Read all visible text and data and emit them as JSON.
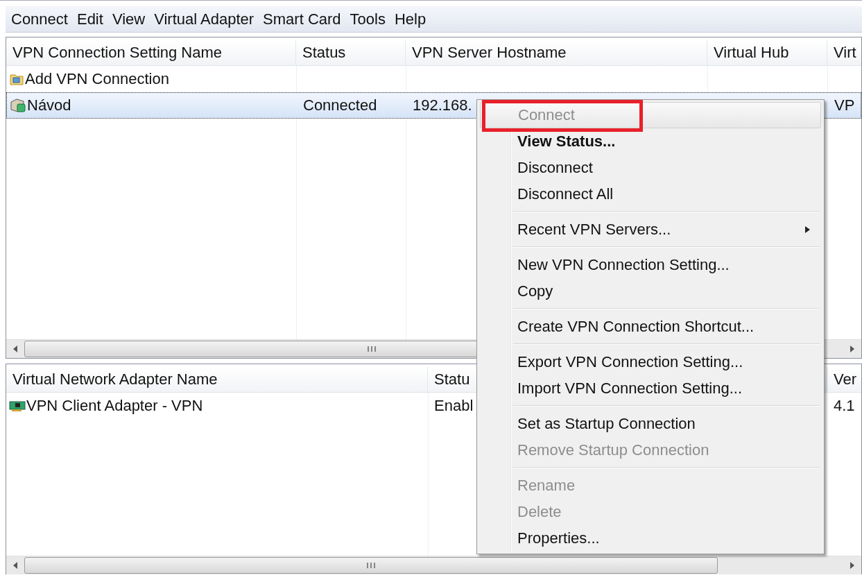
{
  "menubar": [
    {
      "label": "Connect"
    },
    {
      "label": "Edit"
    },
    {
      "label": "View"
    },
    {
      "label": "Virtual Adapter"
    },
    {
      "label": "Smart Card"
    },
    {
      "label": "Tools"
    },
    {
      "label": "Help"
    }
  ],
  "connections": {
    "columns": [
      "VPN Connection Setting Name",
      "Status",
      "VPN Server Hostname",
      "Virtual Hub",
      "Virt"
    ],
    "rows": [
      {
        "kind": "add",
        "selected": false,
        "cells": [
          "Add VPN Connection",
          "",
          "",
          "",
          ""
        ]
      },
      {
        "kind": "connection",
        "selected": true,
        "cells": [
          "Návod",
          "Connected",
          "192.168.",
          "",
          "VP"
        ]
      }
    ]
  },
  "adapters": {
    "columns": [
      "Virtual Network Adapter Name",
      "Statu",
      "Ver"
    ],
    "rows": [
      {
        "kind": "adapter",
        "cells": [
          "VPN Client Adapter - VPN",
          "Enabl",
          "4.1"
        ]
      }
    ]
  },
  "context_menu": {
    "items": [
      {
        "kind": "item",
        "label": "Connect",
        "disabled": true,
        "bold": false,
        "selected": true,
        "submenu": false,
        "highlighted_frame": true
      },
      {
        "kind": "item",
        "label": "View Status...",
        "disabled": false,
        "bold": true,
        "selected": false,
        "submenu": false
      },
      {
        "kind": "item",
        "label": "Disconnect",
        "disabled": false,
        "bold": false,
        "selected": false,
        "submenu": false
      },
      {
        "kind": "item",
        "label": "Disconnect All",
        "disabled": false,
        "bold": false,
        "selected": false,
        "submenu": false
      },
      {
        "kind": "separator"
      },
      {
        "kind": "item",
        "label": "Recent VPN Servers...",
        "disabled": false,
        "bold": false,
        "selected": false,
        "submenu": true
      },
      {
        "kind": "separator"
      },
      {
        "kind": "item",
        "label": "New VPN Connection Setting...",
        "disabled": false,
        "bold": false,
        "selected": false,
        "submenu": false
      },
      {
        "kind": "item",
        "label": "Copy",
        "disabled": false,
        "bold": false,
        "selected": false,
        "submenu": false
      },
      {
        "kind": "separator"
      },
      {
        "kind": "item",
        "label": "Create VPN Connection Shortcut...",
        "disabled": false,
        "bold": false,
        "selected": false,
        "submenu": false
      },
      {
        "kind": "separator"
      },
      {
        "kind": "item",
        "label": "Export VPN Connection Setting...",
        "disabled": false,
        "bold": false,
        "selected": false,
        "submenu": false
      },
      {
        "kind": "item",
        "label": "Import VPN Connection Setting...",
        "disabled": false,
        "bold": false,
        "selected": false,
        "submenu": false
      },
      {
        "kind": "separator"
      },
      {
        "kind": "item",
        "label": "Set as Startup Connection",
        "disabled": false,
        "bold": false,
        "selected": false,
        "submenu": false
      },
      {
        "kind": "item",
        "label": "Remove Startup Connection",
        "disabled": true,
        "bold": false,
        "selected": false,
        "submenu": false
      },
      {
        "kind": "separator"
      },
      {
        "kind": "item",
        "label": "Rename",
        "disabled": true,
        "bold": false,
        "selected": false,
        "submenu": false
      },
      {
        "kind": "item",
        "label": "Delete",
        "disabled": true,
        "bold": false,
        "selected": false,
        "submenu": false
      },
      {
        "kind": "item",
        "label": "Properties...",
        "disabled": false,
        "bold": false,
        "selected": false,
        "submenu": false
      }
    ]
  }
}
